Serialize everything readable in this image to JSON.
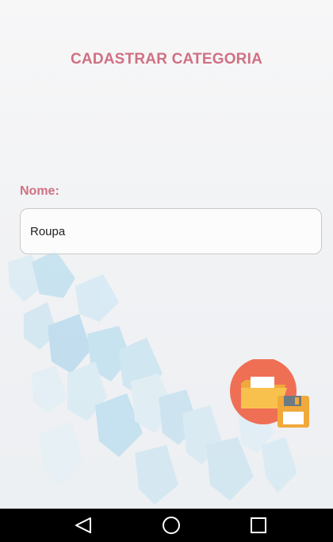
{
  "header": {
    "title": "CADASTRAR CATEGORIA"
  },
  "form": {
    "name_label": "Nome:",
    "name_value": "Roupa"
  },
  "actions": {
    "save_icon": "folder-save-icon"
  },
  "navbar": {
    "back_icon": "back-triangle-icon",
    "home_icon": "home-circle-icon",
    "recents_icon": "recents-square-icon"
  },
  "colors": {
    "accent": "#d07083",
    "fab": "#ef6f55",
    "folder": "#f8c14e",
    "disk": "#f0a93a"
  }
}
